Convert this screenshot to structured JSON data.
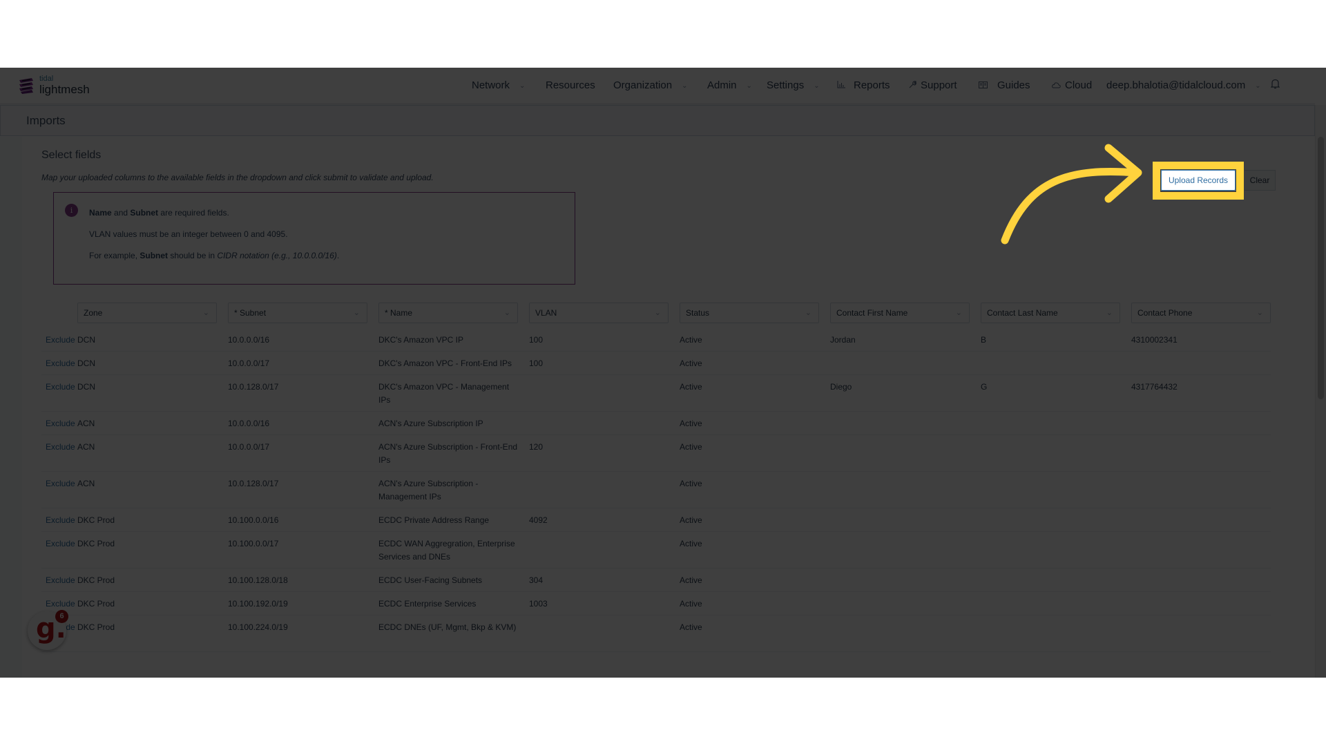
{
  "app": {
    "logo_top": "tidal",
    "logo_bottom": "lightmesh"
  },
  "nav": {
    "items": [
      {
        "label": "Network",
        "has_dropdown": true
      },
      {
        "label": "Resources",
        "has_dropdown": false
      },
      {
        "label": "Organization",
        "has_dropdown": true
      },
      {
        "label": "Admin",
        "has_dropdown": true
      },
      {
        "label": "Settings",
        "has_dropdown": true
      },
      {
        "label": "Reports",
        "icon": "bar-chart-icon"
      },
      {
        "label": "Support",
        "icon": "wrench-icon"
      },
      {
        "label": "Guides",
        "icon": "book-icon"
      },
      {
        "label": "Cloud",
        "icon": "cloud-icon"
      }
    ],
    "user_email": "deep.bhalotia@tidalcloud.com",
    "chevron": "⌄",
    "bell_icon": "bell-icon"
  },
  "page": {
    "title": "Imports",
    "section_title": "Select fields",
    "instructions": "Map your uploaded columns to the available fields in the dropdown and click submit to validate and upload."
  },
  "info": {
    "line1": {
      "b1": "Name",
      "t1": " and ",
      "b2": "Subnet",
      "t2": " are required fields."
    },
    "line2": "VLAN values must be an integer between 0 and 4095.",
    "line3": {
      "t1": "For example, ",
      "b1": "Subnet",
      "t2": " should be in ",
      "i1": "CIDR notation (e.g., 10.0.0.0/16)",
      "t3": "."
    }
  },
  "actions": {
    "upload": "Upload Records",
    "clear": "Clear"
  },
  "highlight_color": "#ffd33d",
  "mapping": {
    "columns": [
      "Zone",
      "* Subnet",
      "* Name",
      "VLAN",
      "Status",
      "Contact First Name",
      "Contact Last Name",
      "Contact Phone"
    ],
    "exclude_label": "Exclude",
    "rows": [
      {
        "zone": "DCN",
        "subnet": "10.0.0.0/16",
        "name": "DKC's Amazon VPC IP",
        "vlan": "100",
        "status": "Active",
        "first": "Jordan",
        "last": "B",
        "phone": "4310002341"
      },
      {
        "zone": "DCN",
        "subnet": "10.0.0.0/17",
        "name": "DKC's Amazon VPC - Front-End IPs",
        "vlan": "100",
        "status": "Active",
        "first": "",
        "last": "",
        "phone": ""
      },
      {
        "zone": "DCN",
        "subnet": "10.0.128.0/17",
        "name": "DKC's Amazon VPC - Management IPs",
        "vlan": "",
        "status": "Active",
        "first": "Diego",
        "last": "G",
        "phone": "4317764432"
      },
      {
        "zone": "ACN",
        "subnet": "10.0.0.0/16",
        "name": "ACN's Azure Subscription IP",
        "vlan": "",
        "status": "Active",
        "first": "",
        "last": "",
        "phone": ""
      },
      {
        "zone": "ACN",
        "subnet": "10.0.0.0/17",
        "name": "ACN's Azure Subscription - Front-End IPs",
        "vlan": "120",
        "status": "Active",
        "first": "",
        "last": "",
        "phone": ""
      },
      {
        "zone": "ACN",
        "subnet": "10.0.128.0/17",
        "name": "ACN's Azure Subscription - Management IPs",
        "vlan": "",
        "status": "Active",
        "first": "",
        "last": "",
        "phone": ""
      },
      {
        "zone": "DKC Prod",
        "subnet": "10.100.0.0/16",
        "name": "ECDC Private Address Range",
        "vlan": "4092",
        "status": "Active",
        "first": "",
        "last": "",
        "phone": ""
      },
      {
        "zone": "DKC Prod",
        "subnet": "10.100.0.0/17",
        "name": "ECDC WAN Aggregration, Enterprise Services and DNEs",
        "vlan": "",
        "status": "Active",
        "first": "",
        "last": "",
        "phone": ""
      },
      {
        "zone": "DKC Prod",
        "subnet": "10.100.128.0/18",
        "name": "ECDC User-Facing Subnets",
        "vlan": "304",
        "status": "Active",
        "first": "",
        "last": "",
        "phone": ""
      },
      {
        "zone": "DKC Prod",
        "subnet": "10.100.192.0/19",
        "name": "ECDC Enterprise Services",
        "vlan": "1003",
        "status": "Active",
        "first": "",
        "last": "",
        "phone": ""
      },
      {
        "zone": "DKC Prod",
        "subnet": "10.100.224.0/19",
        "name": "ECDC DNEs (UF, Mgmt, Bkp & KVM)",
        "vlan": "",
        "status": "Active",
        "first": "",
        "last": "",
        "phone": ""
      }
    ]
  },
  "widget": {
    "glyph": "g.",
    "badge_count": "6"
  }
}
